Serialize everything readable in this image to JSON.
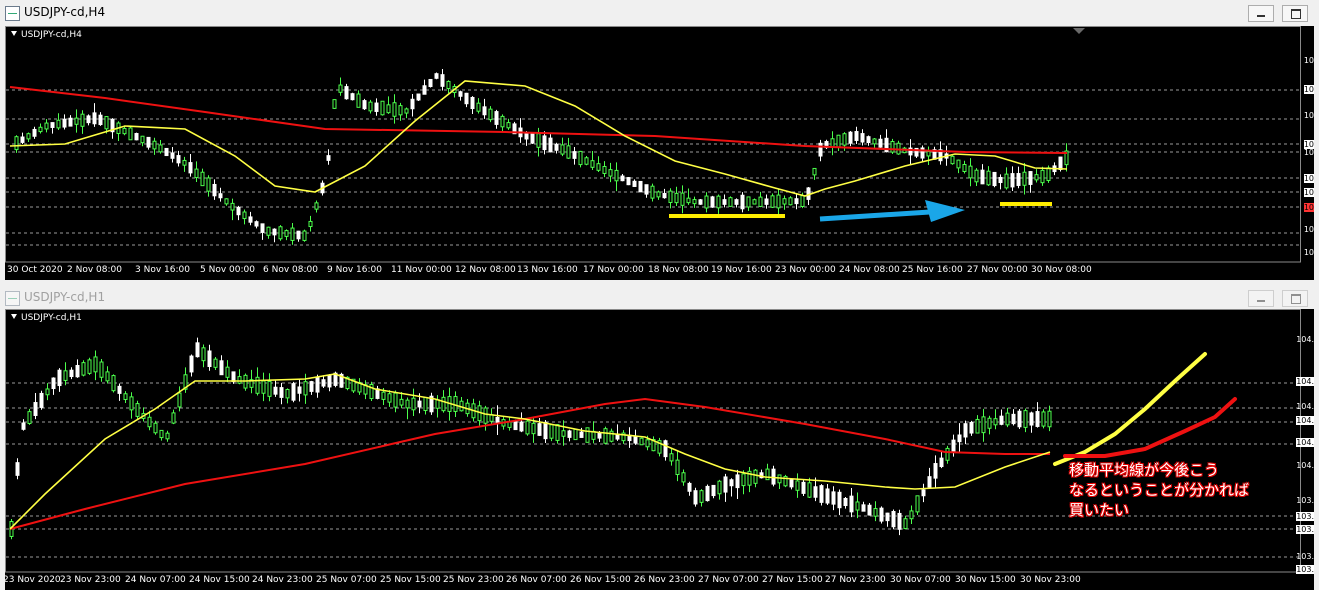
{
  "window_top": {
    "title": "USDJPY-cd,H4",
    "chart_label": "USDJPY-cd,H4",
    "time_labels": [
      "30 Oct 2020",
      "2 Nov 08:00",
      "3 Nov 16:00",
      "5 Nov 00:00",
      "6 Nov 08:00",
      "9 Nov 16:00",
      "11 Nov 00:00",
      "12 Nov 08:00",
      "13 Nov 16:00",
      "17 Nov 00:00",
      "18 Nov 08:00",
      "19 Nov 16:00",
      "23 Nov 00:00",
      "24 Nov 08:00",
      "25 Nov 16:00",
      "27 Nov 00:00",
      "30 Nov 08:00"
    ],
    "price_labels": [
      "10",
      "10",
      "10",
      "10",
      "10",
      "10",
      "10",
      "10",
      "10",
      "10"
    ]
  },
  "window_bottom": {
    "title": "USDJPY-cd,H1",
    "chart_label": "USDJPY-cd,H1",
    "time_labels": [
      "23 Nov 2020",
      "23 Nov 23:00",
      "24 Nov 07:00",
      "24 Nov 15:00",
      "24 Nov 23:00",
      "25 Nov 07:00",
      "25 Nov 15:00",
      "25 Nov 23:00",
      "26 Nov 07:00",
      "26 Nov 15:00",
      "26 Nov 23:00",
      "27 Nov 07:00",
      "27 Nov 15:00",
      "27 Nov 23:00",
      "30 Nov 07:00",
      "30 Nov 15:00",
      "30 Nov 23:00"
    ],
    "price_labels": [
      "104.",
      "104.",
      "104.",
      "104.",
      "104.",
      "104.",
      "103.",
      "103.",
      "103.",
      "103.",
      "103."
    ]
  },
  "annotation": {
    "line1": "移動平均線が今後こう",
    "line2": "なるということが分かれば",
    "line3": "買いたい"
  },
  "colors": {
    "bull": "#4cff4c",
    "bear": "#ffffff",
    "ma_fast": "#ffff44",
    "ma_slow": "#ee1111",
    "marker": "#ffee00",
    "arrow": "#1aa6e8"
  }
}
